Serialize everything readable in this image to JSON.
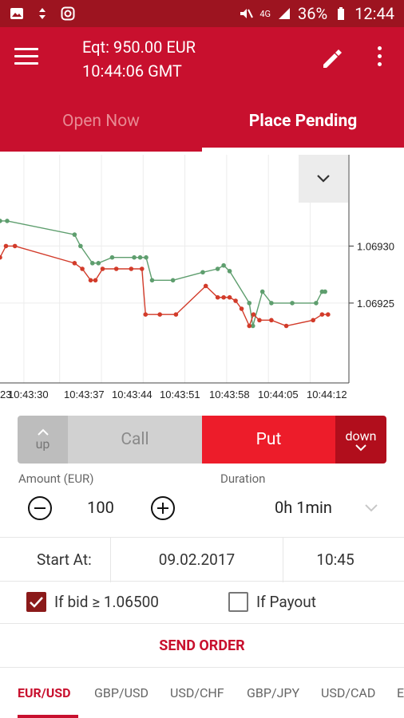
{
  "status_bar": {
    "network": "4G",
    "battery": "36%",
    "clock": "12:44"
  },
  "header": {
    "equity": "Eqt: 950.00 EUR",
    "server_time": "10:44:06 GMT"
  },
  "tabs": [
    {
      "label": "Open Now",
      "active": false
    },
    {
      "label": "Place Pending",
      "active": true
    }
  ],
  "chart_data": {
    "type": "line",
    "x_ticks": [
      "23",
      "10:43:30",
      "10:43:37",
      "10:43:44",
      "10:43:51",
      "10:43:58",
      "10:44:05",
      "10:44:12"
    ],
    "y_ticks": [
      "1.06930",
      "1.06925"
    ],
    "ylim": [
      1.06918,
      1.06938
    ],
    "series": [
      {
        "color": "#5e9e6e",
        "points": [
          [
            0.0,
            1.069322
          ],
          [
            1.2,
            1.069322
          ],
          [
            12.5,
            1.06931
          ],
          [
            13.5,
            1.0693
          ],
          [
            15.5,
            1.069285
          ],
          [
            16.5,
            1.069285
          ],
          [
            18.8,
            1.06929
          ],
          [
            22.5,
            1.06929
          ],
          [
            23.5,
            1.06929
          ],
          [
            24.5,
            1.06929
          ],
          [
            25.5,
            1.06927
          ],
          [
            29.0,
            1.06927
          ],
          [
            34.0,
            1.069277
          ],
          [
            36.5,
            1.06928
          ],
          [
            37.5,
            1.069283
          ],
          [
            38.5,
            1.069278
          ],
          [
            41.8,
            1.06925
          ],
          [
            42.4,
            1.06923
          ],
          [
            44.0,
            1.06926
          ],
          [
            45.5,
            1.06925
          ],
          [
            49.0,
            1.06925
          ],
          [
            53.0,
            1.06925
          ],
          [
            54.0,
            1.06926
          ],
          [
            54.5,
            1.06926
          ]
        ]
      },
      {
        "color": "#d23b2a",
        "points": [
          [
            0.0,
            1.06929
          ],
          [
            1.0,
            1.0693
          ],
          [
            2.5,
            1.0693
          ],
          [
            12.5,
            1.069285
          ],
          [
            13.8,
            1.06928
          ],
          [
            15.2,
            1.06927
          ],
          [
            16.0,
            1.06927
          ],
          [
            17.2,
            1.06928
          ],
          [
            19.5,
            1.06928
          ],
          [
            22.0,
            1.06928
          ],
          [
            23.8,
            1.06928
          ],
          [
            24.4,
            1.06924
          ],
          [
            26.8,
            1.06924
          ],
          [
            29.5,
            1.06924
          ],
          [
            34.5,
            1.069265
          ],
          [
            36.5,
            1.069255
          ],
          [
            37.5,
            1.069255
          ],
          [
            38.5,
            1.069255
          ],
          [
            39.5,
            1.069252
          ],
          [
            40.5,
            1.069245
          ],
          [
            41.8,
            1.06923
          ],
          [
            42.5,
            1.06924
          ],
          [
            43.5,
            1.069235
          ],
          [
            45.5,
            1.069235
          ],
          [
            48.0,
            1.06923
          ],
          [
            52.5,
            1.069235
          ],
          [
            54.0,
            1.06924
          ],
          [
            55.0,
            1.06924
          ]
        ]
      }
    ]
  },
  "trade": {
    "up_label": "up",
    "call_label": "Call",
    "put_label": "Put",
    "down_label": "down"
  },
  "form": {
    "amount_label": "Amount (EUR)",
    "amount_value": "100",
    "duration_label": "Duration",
    "duration_value": "0h 1min",
    "start_label": "Start At:",
    "start_date": "09.02.2017",
    "start_time": "10:45",
    "if_bid_label": "If bid ≥ 1.06500",
    "if_bid_checked": true,
    "if_payout_label": "If Payout",
    "if_payout_checked": false,
    "send_label": "SEND ORDER"
  },
  "pairs": [
    {
      "label": "EUR/USD",
      "active": true
    },
    {
      "label": "GBP/USD",
      "active": false
    },
    {
      "label": "USD/CHF",
      "active": false
    },
    {
      "label": "GBP/JPY",
      "active": false
    },
    {
      "label": "USD/CAD",
      "active": false
    },
    {
      "label": "E",
      "active": false
    }
  ],
  "colors": {
    "primary": "#c8102e",
    "put": "#ed1c2a",
    "down": "#b10e1c",
    "green_series": "#5e9e6e",
    "red_series": "#d23b2a"
  }
}
